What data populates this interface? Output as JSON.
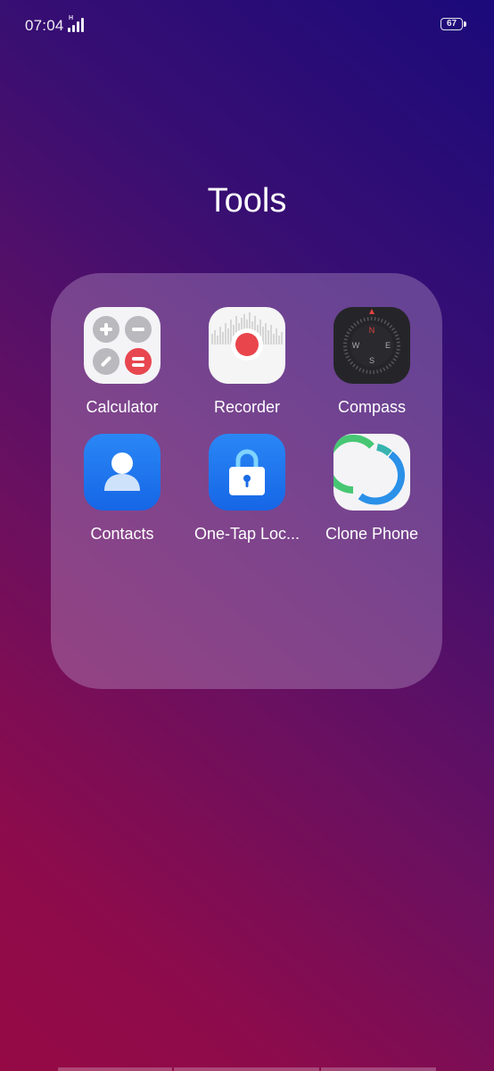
{
  "status": {
    "time": "07:04",
    "signal_label": "H",
    "battery": "67"
  },
  "folder": {
    "title": "Tools",
    "apps": [
      {
        "label": "Calculator",
        "icon": "calculator-icon"
      },
      {
        "label": "Recorder",
        "icon": "recorder-icon"
      },
      {
        "label": "Compass",
        "icon": "compass-icon"
      },
      {
        "label": "Contacts",
        "icon": "contacts-icon"
      },
      {
        "label": "One-Tap Loc...",
        "icon": "lock-icon"
      },
      {
        "label": "Clone Phone",
        "icon": "clone-phone-icon"
      }
    ]
  },
  "compass_letters": {
    "n": "N",
    "e": "E",
    "s": "S",
    "w": "W"
  },
  "colors": {
    "calc_gray": "#b9b9be",
    "calc_red": "#e8474f",
    "recorder_red": "#e9454c",
    "contacts_blue": "#1f7cf0",
    "clone_green": "#47c774",
    "clone_blue": "#2a90e8"
  }
}
